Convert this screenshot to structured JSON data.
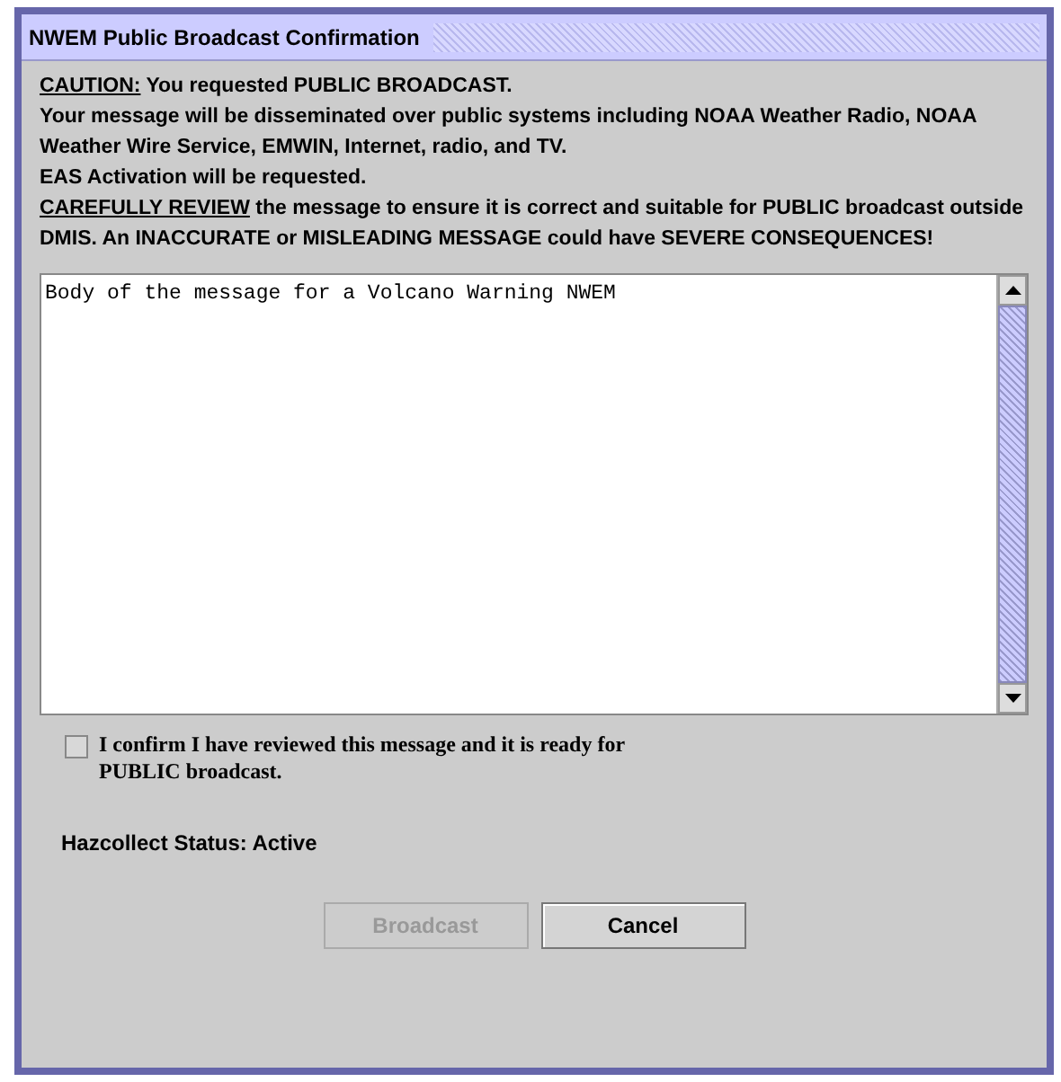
{
  "window": {
    "title": "NWEM Public Broadcast Confirmation"
  },
  "warning": [
    {
      "emphasis": "CAUTION:",
      "text": " You requested PUBLIC BROADCAST."
    },
    {
      "text": "Your message will be disseminated over public systems including NOAA Weather Radio, NOAA Weather Wire Service, EMWIN, Internet, radio, and TV."
    },
    {
      "text": "EAS Activation will be requested."
    },
    {
      "emphasis": "CAREFULLY REVIEW",
      "text": " the message to ensure it is correct and suitable for PUBLIC broadcast outside DMIS. An INACCURATE or MISLEADING MESSAGE could have SEVERE CONSEQUENCES!"
    }
  ],
  "message": {
    "value": "Body of the message for a Volcano Warning NWEM"
  },
  "confirm": {
    "label": "I confirm I have reviewed this message and it is ready for PUBLIC broadcast.",
    "checked": false
  },
  "status": "Hazcollect Status: Active",
  "buttons": [
    {
      "label": "Broadcast",
      "disabled": true
    },
    {
      "label": "Cancel",
      "disabled": false
    }
  ]
}
